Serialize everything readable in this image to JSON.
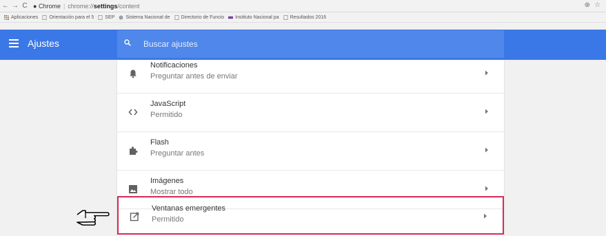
{
  "browser": {
    "tab_site": "Chrome",
    "url_prefix": "chrome://",
    "url_bold": "settings",
    "url_suffix": "/content",
    "bookmarks": [
      {
        "label": "Aplicaciones",
        "icon": "apps-icon"
      },
      {
        "label": "Orientación para el 5",
        "icon": "page-icon"
      },
      {
        "label": "SEP",
        "icon": "page-icon"
      },
      {
        "label": "Sistema Nacional de",
        "icon": "globe-icon"
      },
      {
        "label": "Directorio de Funcio",
        "icon": "page-icon"
      },
      {
        "label": "Instituto Nacional pa",
        "icon": "ine-icon"
      },
      {
        "label": "Resultados 2016",
        "icon": "page-icon"
      }
    ]
  },
  "header": {
    "title": "Ajustes",
    "search_placeholder": "Buscar ajustes",
    "accent": "#3b78e7"
  },
  "settings": [
    {
      "label": "Notificaciones",
      "value": "Preguntar antes de enviar",
      "icon": "bell-icon"
    },
    {
      "label": "JavaScript",
      "value": "Permitido",
      "icon": "code-icon"
    },
    {
      "label": "Flash",
      "value": "Preguntar antes",
      "icon": "puzzle-icon"
    },
    {
      "label": "Imágenes",
      "value": "Mostrar todo",
      "icon": "image-icon"
    },
    {
      "label": "Ventanas emergentes",
      "value": "Permitido",
      "icon": "popup-icon",
      "highlighted": true
    }
  ],
  "highlight_color": "#d62a57"
}
